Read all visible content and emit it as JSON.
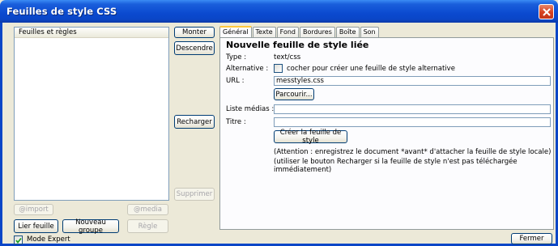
{
  "window": {
    "title": "Feuilles de style CSS"
  },
  "left": {
    "list_header": "Feuilles et règles",
    "import_label": "@import",
    "media_label": "@media",
    "link_label": "Lier feuille",
    "new_group_label": "Nouveau groupe",
    "rule_label": "Règle",
    "expert_mode_label": "Mode Expert",
    "expert_mode_checked": true
  },
  "middle": {
    "up_label": "Monter",
    "down_label": "Descendre",
    "reload_label": "Recharger",
    "delete_label": "Supprimer"
  },
  "tabs": [
    {
      "label": "Général",
      "active": true
    },
    {
      "label": "Texte",
      "active": false
    },
    {
      "label": "Fond",
      "active": false
    },
    {
      "label": "Bordures",
      "active": false
    },
    {
      "label": "Boîte",
      "active": false
    },
    {
      "label": "Son",
      "active": false
    }
  ],
  "general": {
    "heading": "Nouvelle feuille de style liée",
    "type_label": "Type :",
    "type_value": "text/css",
    "alternative_label": "Alternative :",
    "alternative_text": "cocher pour créer une feuille de style alternative",
    "url_label": "URL :",
    "url_value": "messtyles.css",
    "browse_label": "Parcourir...",
    "media_list_label": "Liste médias :",
    "media_list_value": "",
    "title_label": "Titre :",
    "title_value": "",
    "create_label": "Créer la feuille de style",
    "note_line1": "(Attention : enregistrez le document *avant* d'attacher la feuille de style locale)",
    "note_line2": "(utiliser le bouton Recharger si la feuille de style n'est pas téléchargée immédiatement)"
  },
  "footer": {
    "close_label": "Fermer"
  },
  "colors": {
    "titlebar": "#0a46c7",
    "close": "#d6401f",
    "dialog_bg": "#ece9d8",
    "tab_highlight": "#ffc83c"
  }
}
